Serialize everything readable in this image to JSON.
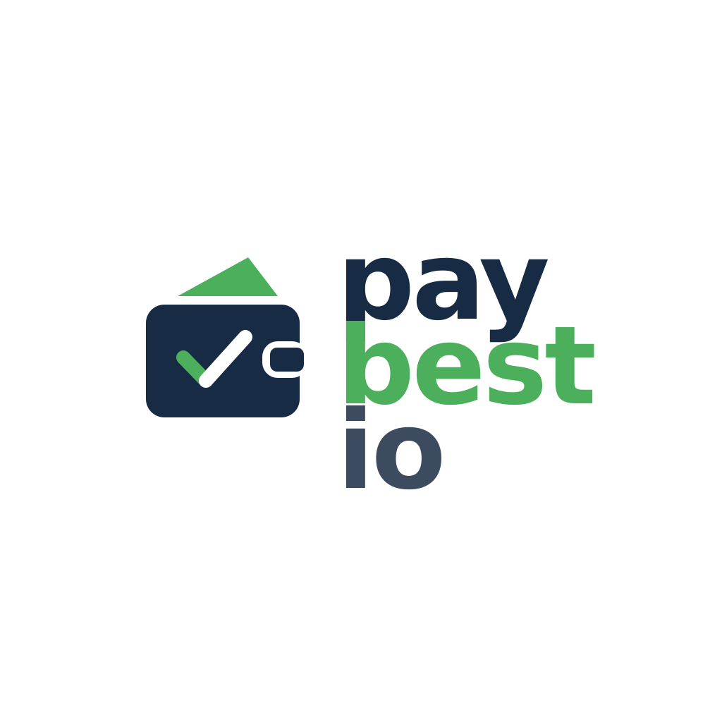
{
  "logo": {
    "icon": "wallet-check-icon",
    "words": {
      "line1": "pay",
      "line2": "best",
      "line3": "io"
    },
    "colors": {
      "navy": "#172b45",
      "green": "#4caf5b",
      "slate": "#3c4b60",
      "background": "#ffffff"
    }
  }
}
